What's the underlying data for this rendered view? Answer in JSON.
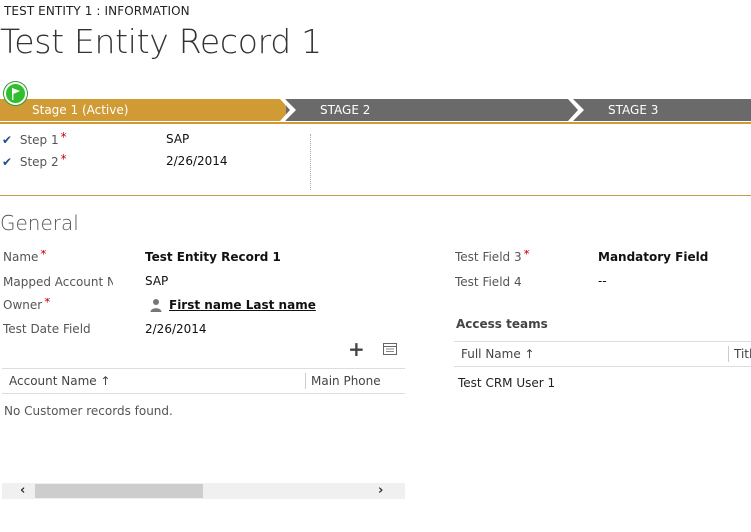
{
  "header": {
    "entity_type": "TEST ENTITY 1 : INFORMATION",
    "record_title": "Test Entity Record 1"
  },
  "process": {
    "stages": [
      {
        "label": "Stage 1 (Active)",
        "active": true
      },
      {
        "label": "STAGE 2",
        "active": false
      },
      {
        "label": "STAGE 3",
        "active": false
      }
    ],
    "steps": [
      {
        "label": "Step 1",
        "required_mark": "*",
        "value": "SAP"
      },
      {
        "label": "Step 2",
        "required_mark": "*",
        "value": "2/26/2014"
      }
    ],
    "colors": {
      "active": "#d09a35",
      "inactive": "#6a6a6a",
      "flag": "#2fbf2f"
    }
  },
  "general": {
    "title": "General",
    "left_fields": [
      {
        "label": "Name",
        "required_mark": "*",
        "value": "Test Entity Record 1"
      },
      {
        "label": "Mapped Account Nu",
        "required_mark": "",
        "value": "SAP"
      },
      {
        "label": "Owner",
        "required_mark": "*",
        "value": "First name Last name"
      },
      {
        "label": "Test Date Field",
        "required_mark": "",
        "value": "2/26/2014"
      }
    ],
    "right_fields": [
      {
        "label": "Test Field 3",
        "required_mark": "*",
        "value": "Mandatory Field"
      },
      {
        "label": "Test Field 4",
        "required_mark": "",
        "value": "--"
      }
    ]
  },
  "subgrid": {
    "add_label": "+",
    "columns": [
      "Account Name ↑",
      "Main Phone"
    ],
    "empty_message": "No Customer records found.",
    "scroll_left": "‹",
    "scroll_right": "›"
  },
  "access_teams": {
    "title": "Access teams",
    "columns": [
      "Full Name ↑",
      "Titl"
    ],
    "rows": [
      "Test CRM User 1"
    ]
  },
  "icons": {
    "check": "✔",
    "flag": "flag-icon",
    "person": "person-icon",
    "grid_view": "grid-view-icon"
  }
}
